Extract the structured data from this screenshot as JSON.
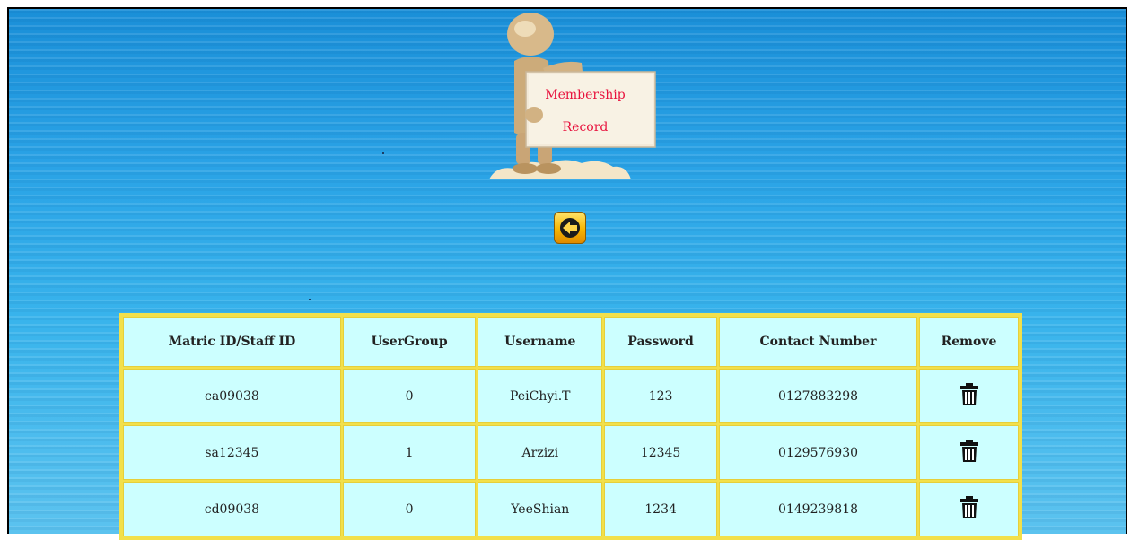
{
  "banner": {
    "sign_line1": "Membership",
    "sign_line2": "Record"
  },
  "nav": {
    "back_icon": "arrow-left-icon"
  },
  "table": {
    "headers": [
      "Matric ID/Staff ID",
      "UserGroup",
      "Username",
      "Password",
      "Contact Number",
      "Remove"
    ],
    "rows": [
      {
        "id": "ca09038",
        "group": "0",
        "username": "PeiChyi.T",
        "password": "123",
        "contact": "0127883298",
        "remove_icon": "trash-icon"
      },
      {
        "id": "sa12345",
        "group": "1",
        "username": "Arzizi",
        "password": "12345",
        "contact": "0129576930",
        "remove_icon": "trash-icon"
      },
      {
        "id": "cd09038",
        "group": "0",
        "username": "YeeShian",
        "password": "1234",
        "contact": "0149239818",
        "remove_icon": "trash-icon"
      }
    ]
  },
  "colors": {
    "background": "#2aa7e4",
    "table_cell": "#ccffff",
    "table_border": "#f2e04a",
    "sign_text": "#e8123d",
    "button": "#f7b500"
  }
}
